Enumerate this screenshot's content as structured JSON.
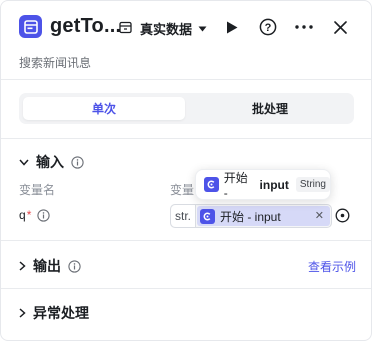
{
  "header": {
    "title": "getTo...",
    "data_mode": "真实数据",
    "subtitle": "搜索新闻讯息",
    "icons": [
      "app-icon",
      "library-icon",
      "chevron-down-icon",
      "play-icon",
      "help-icon",
      "more-icon",
      "close-icon"
    ]
  },
  "mode_tabs": {
    "single": "单次",
    "batch": "批处理",
    "active": "single"
  },
  "input_section": {
    "title": "输入",
    "col_var_name": "变量名",
    "col_var_value": "变量",
    "fields": [
      {
        "name": "q",
        "required_mark": "*",
        "type_tag": "str.",
        "ref_label": "开始 - input"
      }
    ],
    "popover": {
      "node": "开始 -",
      "var": "input",
      "type": "String"
    }
  },
  "output_section": {
    "title": "输出",
    "link": "查看示例"
  },
  "error_section": {
    "title": "异常处理"
  },
  "colors": {
    "accent": "#4d53e8",
    "required": "#e5484d",
    "chip_bg": "#d6d9f7"
  }
}
